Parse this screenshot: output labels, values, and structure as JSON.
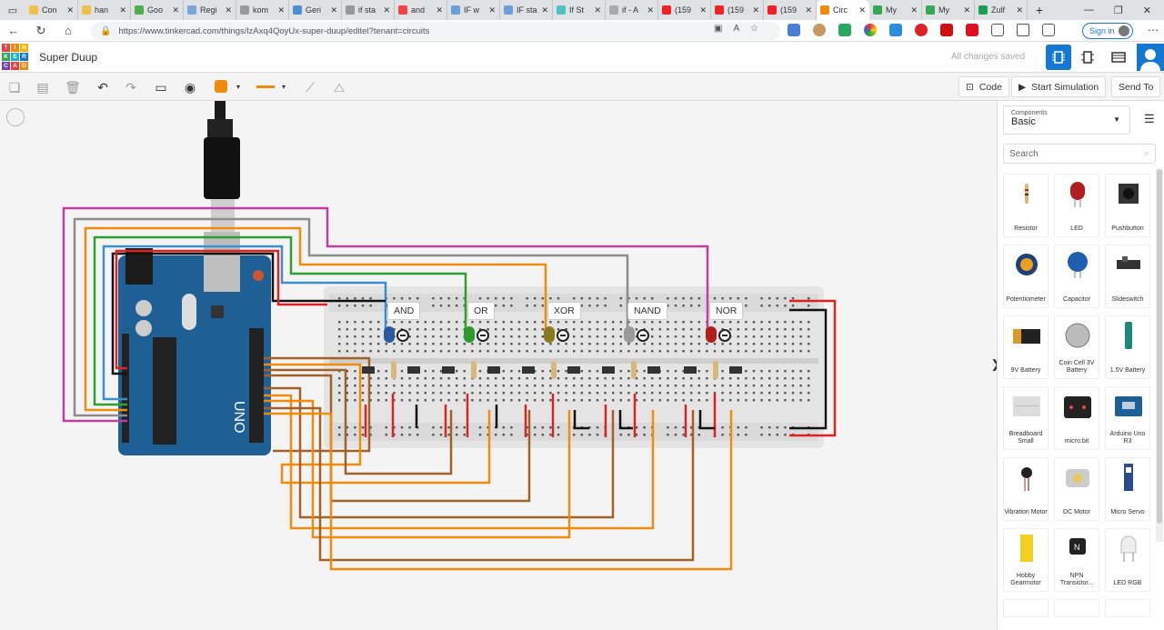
{
  "browser": {
    "tabs": [
      "Con",
      "han",
      "Goo",
      "Regi",
      "kom",
      "Geri",
      "if sta",
      "and",
      "IF w",
      "IF sta",
      "If St",
      "if - A",
      "(159",
      "(159",
      "(159",
      "Circ",
      "My",
      "My",
      "Zulf"
    ],
    "active_tab": "Circ",
    "url": "https://www.tinkercad.com/things/lzAxq4QoyUx-super-duup/editel?tenant=circuits",
    "signin": "Sign in"
  },
  "header": {
    "logo_letters": [
      "TIN",
      "KER",
      "CAD"
    ],
    "project_title": "Super Duup",
    "save_status": "All changes saved"
  },
  "toolbar": {
    "code_label": "Code",
    "simulate_label": "Start Simulation",
    "send_label": "Send To",
    "color_value": "#f08c0c"
  },
  "circuit": {
    "gate_labels": [
      "AND",
      "OR",
      "XOR",
      "NAND",
      "NOR"
    ],
    "led_colors": [
      "#2a5aa0",
      "#2c9a2c",
      "#8c7a1a",
      "#9a9a9a",
      "#b01e1e"
    ],
    "board": "Arduino UNO"
  },
  "panel": {
    "components_small": "Components",
    "components_value": "Basic",
    "search_placeholder": "Search",
    "items": [
      {
        "label": "Resistor",
        "icon": "resistor-icon"
      },
      {
        "label": "LED",
        "icon": "led-icon"
      },
      {
        "label": "Pushbutton",
        "icon": "pushbutton-icon"
      },
      {
        "label": "Potentiometer",
        "icon": "potentiometer-icon"
      },
      {
        "label": "Capacitor",
        "icon": "capacitor-icon"
      },
      {
        "label": "Slideswitch",
        "icon": "slideswitch-icon"
      },
      {
        "label": "9V Battery",
        "icon": "battery-9v-icon"
      },
      {
        "label": "Coin Cell 3V Battery",
        "icon": "coin-cell-icon"
      },
      {
        "label": "1.5V Battery",
        "icon": "battery-aa-icon"
      },
      {
        "label": "Breadboard Small",
        "icon": "breadboard-icon"
      },
      {
        "label": "micro:bit",
        "icon": "microbit-icon"
      },
      {
        "label": "Arduino Uno R3",
        "icon": "arduino-icon"
      },
      {
        "label": "Vibration Motor",
        "icon": "vibration-motor-icon"
      },
      {
        "label": "DC Motor",
        "icon": "dc-motor-icon"
      },
      {
        "label": "Micro Servo",
        "icon": "servo-icon"
      },
      {
        "label": "Hobby Gearmotor",
        "icon": "gearmotor-icon"
      },
      {
        "label": "NPN Transistor...",
        "icon": "transistor-icon"
      },
      {
        "label": "LED RGB",
        "icon": "led-rgb-icon"
      }
    ]
  }
}
